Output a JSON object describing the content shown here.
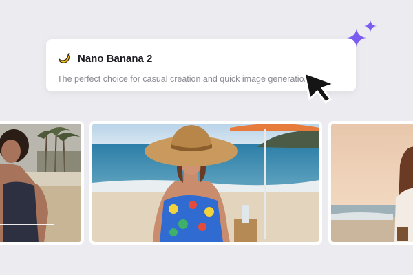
{
  "model_card": {
    "icon": "banana-icon",
    "title": "Nano Banana 2",
    "description": "The perfect choice for casual creation and quick image generation."
  },
  "cursor_icon": "arrow-cursor-icon",
  "sparkle_color": "#7b5cf0",
  "photos": [
    {
      "name": "beach-photo-woman-dark-tank"
    },
    {
      "name": "beach-photo-woman-sun-hat"
    },
    {
      "name": "beach-photo-woman-sunset"
    }
  ],
  "colors": {
    "background": "#ecebef",
    "card": "#ffffff",
    "title": "#1c1c22",
    "description": "#8a8a92"
  }
}
